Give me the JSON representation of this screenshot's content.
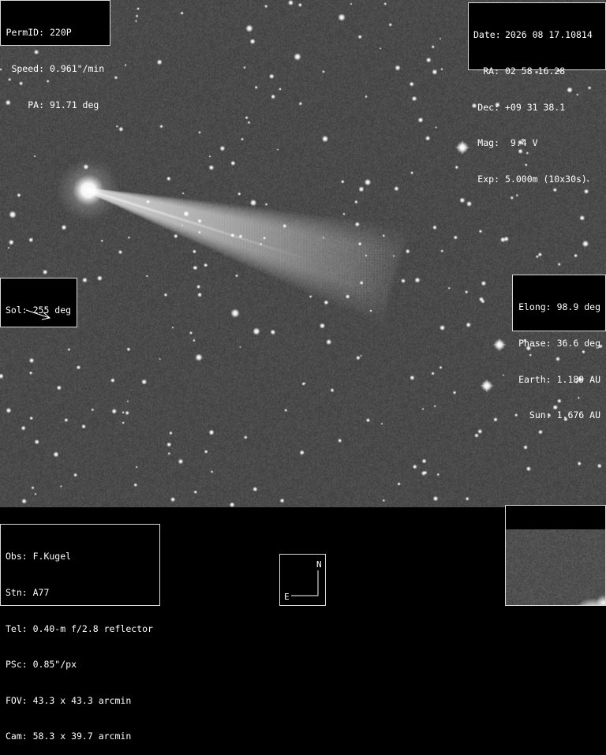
{
  "object_box": {
    "permid_key": "PermID:",
    "permid_val": "220P",
    "speed_key": "Speed:",
    "speed_val": "0.961\"/min",
    "pa_key": "PA:",
    "pa_val": "91.71 deg"
  },
  "ephem_box": {
    "date_key": "Date:",
    "date_val": "2026 08 17.10814",
    "ra_key": "RA:",
    "ra_val": "02 58 16.28",
    "dec_key": "Dec:",
    "dec_val": "+09 31 38.1",
    "mag_key": "Mag:",
    "mag_val": " 9.4 V",
    "exp_key": "Exp:",
    "exp_val": "5.000m (10x30s)"
  },
  "sun_box": {
    "label": "Sol: 255 deg",
    "arrow_angle_deg": 255
  },
  "geometry_box": {
    "elong_key": "Elong:",
    "elong_val": "98.9 deg",
    "phase_key": "Phase:",
    "phase_val": "36.6 deg",
    "earth_key": "Earth:",
    "earth_val": "1.189 AU",
    "sun_key": "Sun:",
    "sun_val": "1.676 AU"
  },
  "observer_box": {
    "obs": "Obs: F.Kugel",
    "stn": "Stn: A77",
    "tel": "Tel: 0.40-m f/2.8 reflector",
    "psc": "PSc: 0.85\"/px",
    "fov": "FOV: 43.3 x 43.3 arcmin",
    "cam": "Cam: 58.3 x 39.7 arcmin"
  },
  "orientation": {
    "north": "N",
    "east": "E"
  },
  "colors": {
    "sky": "#4a4a4a",
    "panel": "#000000",
    "text": "#ffffff",
    "border": "#d8d8d8"
  }
}
